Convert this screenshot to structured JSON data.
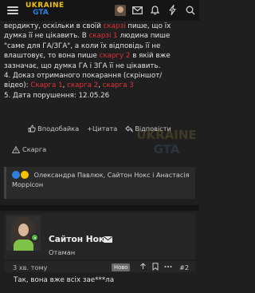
{
  "header": {
    "logo_line1": "UKRAINE",
    "logo_line2": "GTA",
    "icons": [
      "menu-icon",
      "avatar",
      "envelope-icon",
      "bell-icon",
      "lightning-icon",
      "search-icon"
    ]
  },
  "post": {
    "line1_a": "вердикту, оскільки в своїй ",
    "line1_link": "скарзі",
    "line1_b": " пише, що їх",
    "line2": "думка її не цікавить. В ",
    "line2_link": "скарзі 1",
    "line2_b": " людина пише",
    "line3": "\"саме для ГА/ЗГА\", а коли їх відповідь її не",
    "line4_a": "влаштовує, то вона пише ",
    "line4_link": "скаргу 2",
    "line4_b": " в якій вже",
    "line5": "зазначає, що думка ГА і ЗГА її не цікавить.",
    "line6": "4. Доказ отриманого покарання (скріншот/",
    "line7_a": "відео): ",
    "line7_link1": "Скарга 1",
    "line7_sep1": ", ",
    "line7_link2": "скарга 2",
    "line7_sep2": ", ",
    "line7_link3": "скарга 3",
    "line8": "5. Дата порушення: 12.05.26",
    "link_color": "#e0313a"
  },
  "actions": {
    "like_label": "Вподобайка",
    "quote_label": "+Цитата",
    "reply_label": "Відповісти",
    "report_label": "Скарга"
  },
  "watermark": {
    "line1": "UKRAINE",
    "line2": "GTA"
  },
  "reactions": {
    "text": "Олександра Павлюк, Сайтон Нокс і Анастасія Моррісон"
  },
  "reply": {
    "author": "Сайтон Нокс",
    "role": "Отаман",
    "time": "3 хв. тому",
    "badge": "Ново",
    "post_number": "#2",
    "text": "Так, вона вже всіх зае***ла",
    "online_color": "#55b34b"
  }
}
